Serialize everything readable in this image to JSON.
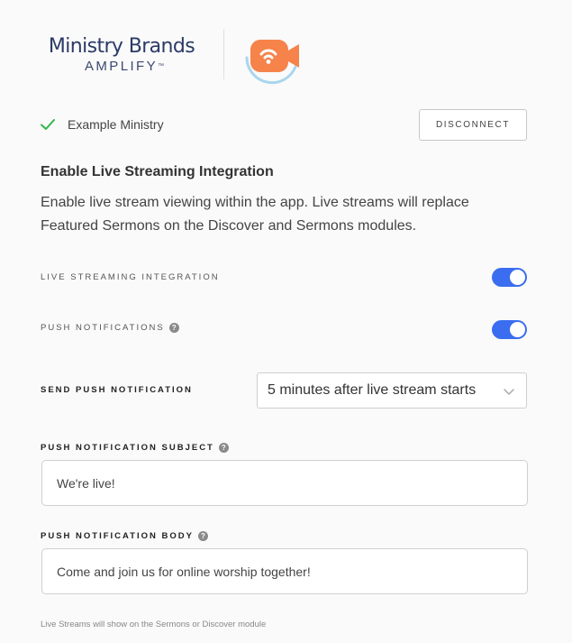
{
  "brand": {
    "name": "Ministry Brands",
    "product": "AMPLIFY",
    "trademark": "™",
    "colors": {
      "navy": "#2b3a67",
      "logo_orange": "#f5834a",
      "logo_blue": "#a9d6ee"
    }
  },
  "account": {
    "status_icon": "check-icon",
    "name": "Example Ministry",
    "disconnect_label": "DISCONNECT"
  },
  "section": {
    "title": "Enable Live Streaming Integration",
    "description": "Enable live stream viewing within the app. Live streams will replace Featured Sermons on the Discover and Sermons modules."
  },
  "settings": {
    "live_streaming": {
      "label": "LIVE STREAMING INTEGRATION",
      "enabled": true
    },
    "push_notifications": {
      "label": "PUSH NOTIFICATIONS",
      "help": "?",
      "enabled": true
    },
    "send_push": {
      "label": "SEND PUSH NOTIFICATION",
      "selected": "5 minutes after live stream starts"
    },
    "subject": {
      "label": "PUSH NOTIFICATION SUBJECT",
      "help": "?",
      "value": "We're live!"
    },
    "body": {
      "label": "PUSH NOTIFICATION BODY",
      "help": "?",
      "value": "Come and join us for online worship together!"
    }
  },
  "footer": {
    "note": "Live Streams will show on the Sermons or Discover module"
  },
  "colors": {
    "accent": "#3a6df0",
    "success": "#2db84c"
  }
}
